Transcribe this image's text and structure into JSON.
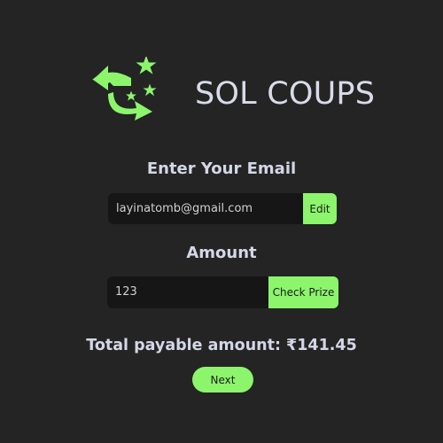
{
  "brand": {
    "name": "SOL COUPS",
    "logo_icon": "star-arrows-logo-icon",
    "accent_color": "#8cf56c"
  },
  "email_section": {
    "label": "Enter Your Email",
    "value": "layinatomb@gmail.com",
    "edit_label": "Edit"
  },
  "amount_section": {
    "label": "Amount",
    "value": "123",
    "check_label": "Check Prize"
  },
  "total": {
    "text": "Total payable amount: ₹141.45"
  },
  "actions": {
    "next_label": "Next"
  }
}
